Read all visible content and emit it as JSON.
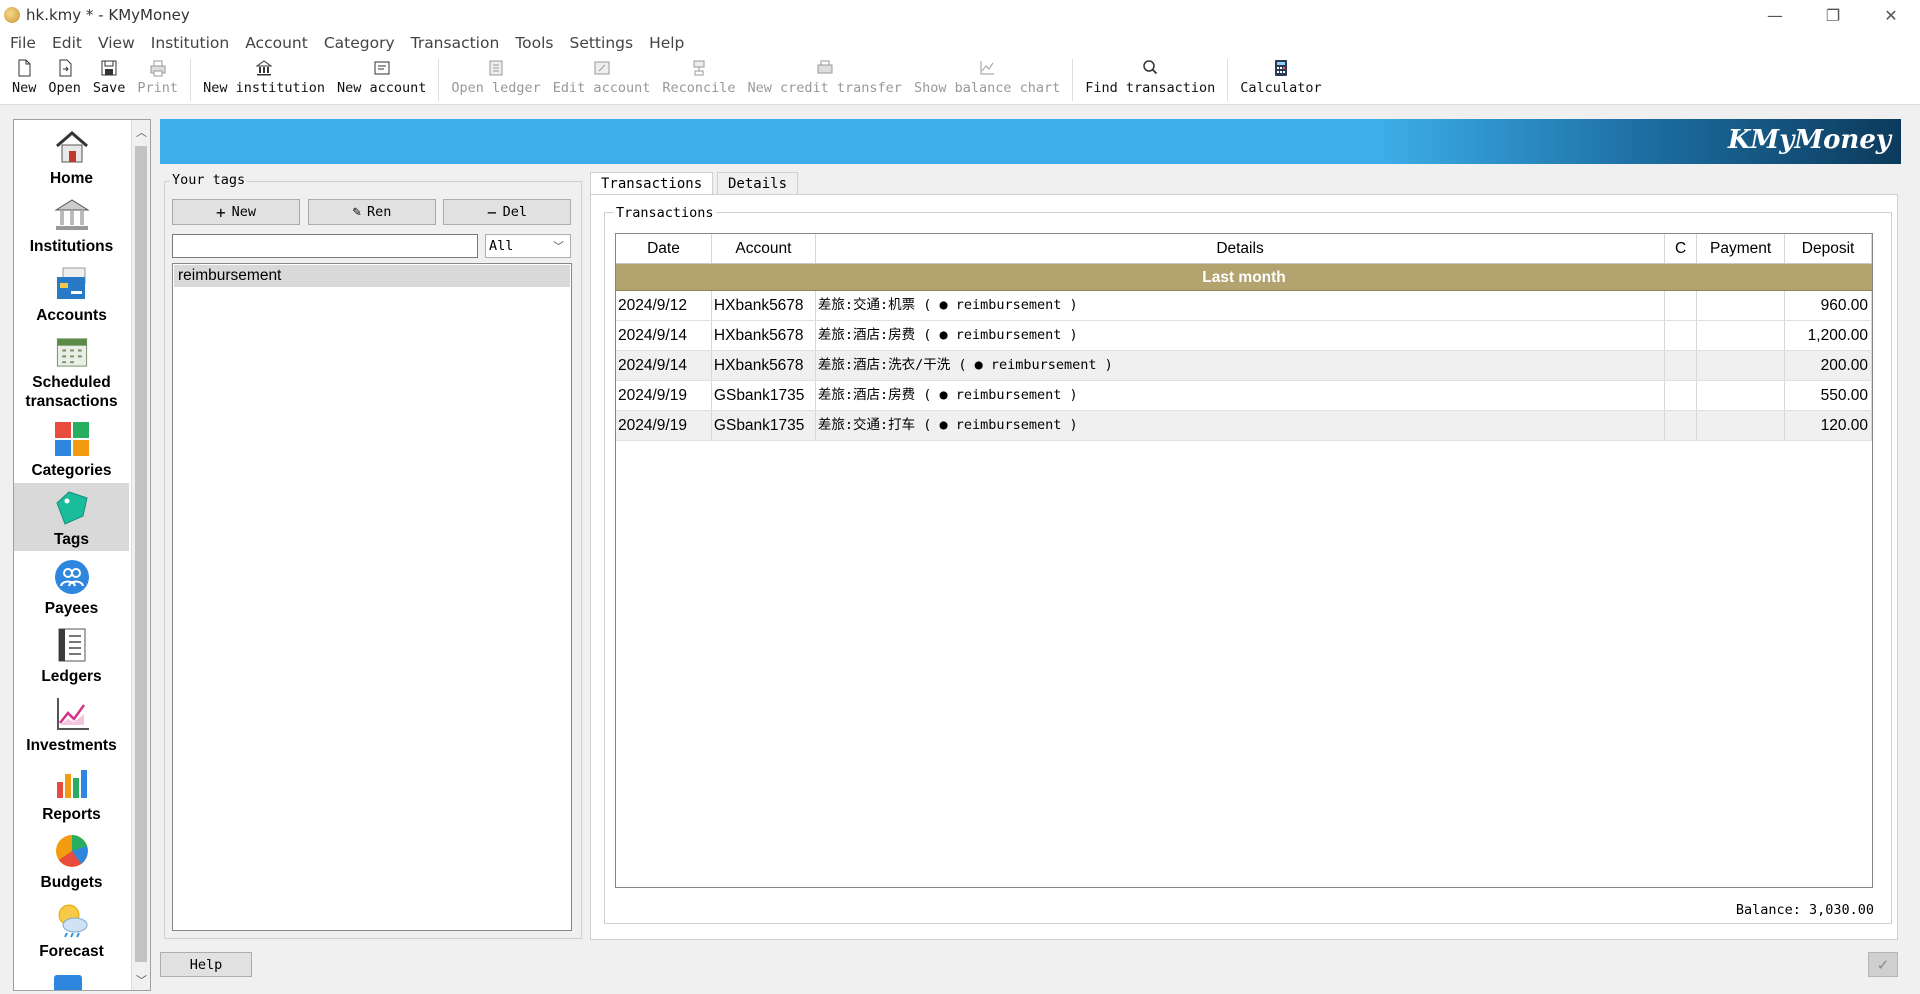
{
  "window": {
    "title": "hk.kmy * - KMyMoney",
    "minimize": "—",
    "restore": "❐",
    "close": "✕"
  },
  "menu": [
    "File",
    "Edit",
    "View",
    "Institution",
    "Account",
    "Category",
    "Transaction",
    "Tools",
    "Settings",
    "Help"
  ],
  "toolbar": {
    "new": "New",
    "open": "Open",
    "save": "Save",
    "print": "Print",
    "new_institution": "New institution",
    "new_account": "New account",
    "open_ledger": "Open ledger",
    "edit_account": "Edit account",
    "reconcile": "Reconcile",
    "new_credit_transfer": "New credit transfer",
    "show_balance_chart": "Show balance chart",
    "find_transaction": "Find transaction",
    "calculator": "Calculator"
  },
  "sidebar": {
    "items": [
      {
        "label": "Home"
      },
      {
        "label": "Institutions"
      },
      {
        "label": "Accounts"
      },
      {
        "label": "Scheduled\ntransactions"
      },
      {
        "label": "Categories"
      },
      {
        "label": "Tags"
      },
      {
        "label": "Payees"
      },
      {
        "label": "Ledgers"
      },
      {
        "label": "Investments"
      },
      {
        "label": "Reports"
      },
      {
        "label": "Budgets"
      },
      {
        "label": "Forecast"
      }
    ],
    "active": "Tags"
  },
  "banner": {
    "logo": "KMyMoney"
  },
  "tags": {
    "title": "Your tags",
    "new_btn": "New",
    "ren_btn": "Ren",
    "del_btn": "Del",
    "search_value": "",
    "filter": "All",
    "items": [
      "reimbursement"
    ]
  },
  "tabs": {
    "transactions": "Transactions",
    "details": "Details"
  },
  "ledger": {
    "group_title": "Transactions",
    "headers": {
      "date": "Date",
      "account": "Account",
      "details": "Details",
      "c": "C",
      "payment": "Payment",
      "deposit": "Deposit"
    },
    "group_label": "Last month",
    "rows": [
      {
        "date": "2024/9/12",
        "account": "HXbank5678",
        "details": "差旅:交通:机票 ( ● reimbursement )",
        "c": "",
        "payment": "",
        "deposit": "960.00"
      },
      {
        "date": "2024/9/14",
        "account": "HXbank5678",
        "details": "差旅:酒店:房费 ( ● reimbursement )",
        "c": "",
        "payment": "",
        "deposit": "1,200.00"
      },
      {
        "date": "2024/9/14",
        "account": "HXbank5678",
        "details": "差旅:酒店:洗衣/干洗 ( ● reimbursement )",
        "c": "",
        "payment": "",
        "deposit": "200.00"
      },
      {
        "date": "2024/9/19",
        "account": "GSbank1735",
        "details": "差旅:酒店:房费 ( ● reimbursement )",
        "c": "",
        "payment": "",
        "deposit": "550.00"
      },
      {
        "date": "2024/9/19",
        "account": "GSbank1735",
        "details": "差旅:交通:打车 ( ● reimbursement )",
        "c": "",
        "payment": "",
        "deposit": "120.00"
      }
    ],
    "balance": "Balance: 3,030.00"
  },
  "footer": {
    "help": "Help"
  },
  "colors": {
    "accent": "#3daee9",
    "group_row": "#b3a36e",
    "active_nav": "#d9d9d9"
  }
}
